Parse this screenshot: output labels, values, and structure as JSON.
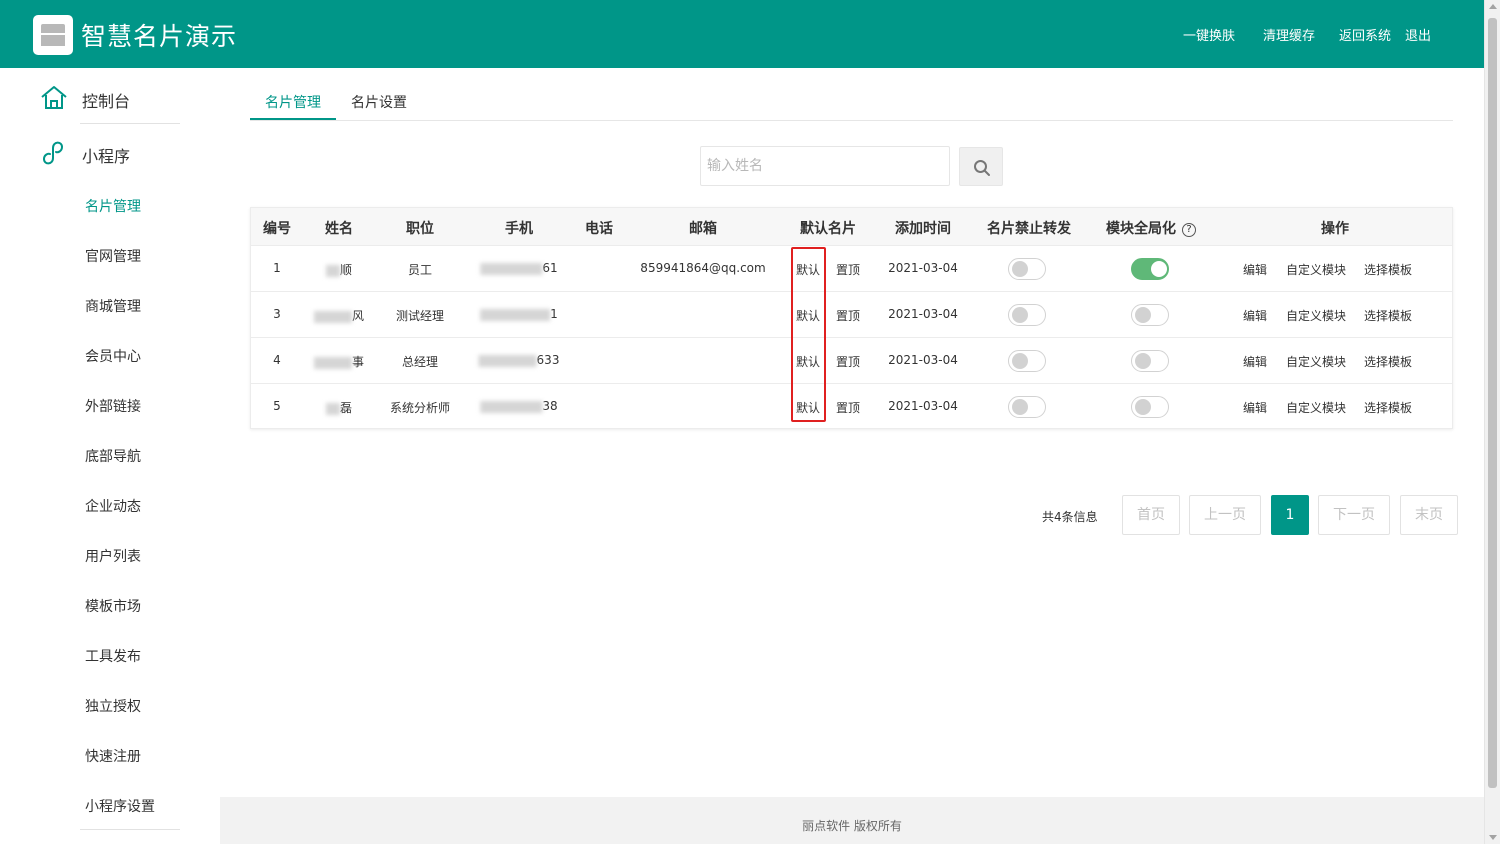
{
  "header": {
    "app_title": "智慧名片演示",
    "links": [
      "一键换肤",
      "清理缓存",
      "返回系统",
      "退出"
    ]
  },
  "sidebar": {
    "top_items": [
      {
        "label": "控制台",
        "icon": "home-icon"
      },
      {
        "label": "小程序",
        "icon": "miniprogram-icon"
      }
    ],
    "sub_items": [
      "名片管理",
      "官网管理",
      "商城管理",
      "会员中心",
      "外部链接",
      "底部导航",
      "企业动态",
      "用户列表",
      "模板市场",
      "工具发布",
      "独立授权",
      "快速注册",
      "小程序设置"
    ],
    "active_item": "名片管理"
  },
  "tabs": [
    "名片管理",
    "名片设置"
  ],
  "search": {
    "placeholder": "输入姓名",
    "value": ""
  },
  "table": {
    "headers": [
      "编号",
      "姓名",
      "职位",
      "手机",
      "电话",
      "邮箱",
      "默认名片",
      "添加时间",
      "名片禁止转发",
      "模块全局化",
      "操作"
    ],
    "rows": [
      {
        "id": "1",
        "name_visible": "顺",
        "position": "员工",
        "phone_visible": "61",
        "tel": "",
        "email": "859941864@qq.com",
        "default": "默认",
        "top": "置顶",
        "date": "2021-03-04",
        "forbid_forward": false,
        "module_global": true,
        "actions": [
          "编辑",
          "自定义模块",
          "选择模板"
        ]
      },
      {
        "id": "3",
        "name_visible": "风",
        "position": "测试经理",
        "phone_visible": "1",
        "tel": "",
        "email": "",
        "default": "默认",
        "top": "置顶",
        "date": "2021-03-04",
        "forbid_forward": false,
        "module_global": false,
        "actions": [
          "编辑",
          "自定义模块",
          "选择模板"
        ]
      },
      {
        "id": "4",
        "name_visible": "事",
        "position": "总经理",
        "phone_visible": "633",
        "tel": "",
        "email": "",
        "default": "默认",
        "top": "置顶",
        "date": "2021-03-04",
        "forbid_forward": false,
        "module_global": false,
        "actions": [
          "编辑",
          "自定义模块",
          "选择模板"
        ]
      },
      {
        "id": "5",
        "name_visible": "磊",
        "position": "系统分析师",
        "phone_visible": "38",
        "tel": "",
        "email": "",
        "default": "默认",
        "top": "置顶",
        "date": "2021-03-04",
        "forbid_forward": false,
        "module_global": false,
        "actions": [
          "编辑",
          "自定义模块",
          "选择模板"
        ]
      }
    ]
  },
  "pagination": {
    "total_text": "共4条信息",
    "first": "首页",
    "prev": "上一页",
    "current": "1",
    "next": "下一页",
    "last": "末页"
  },
  "footer": {
    "text": "丽点软件 版权所有"
  },
  "colors": {
    "primary": "#009688",
    "toggle_on": "#5fb878",
    "highlight": "#e02020"
  }
}
